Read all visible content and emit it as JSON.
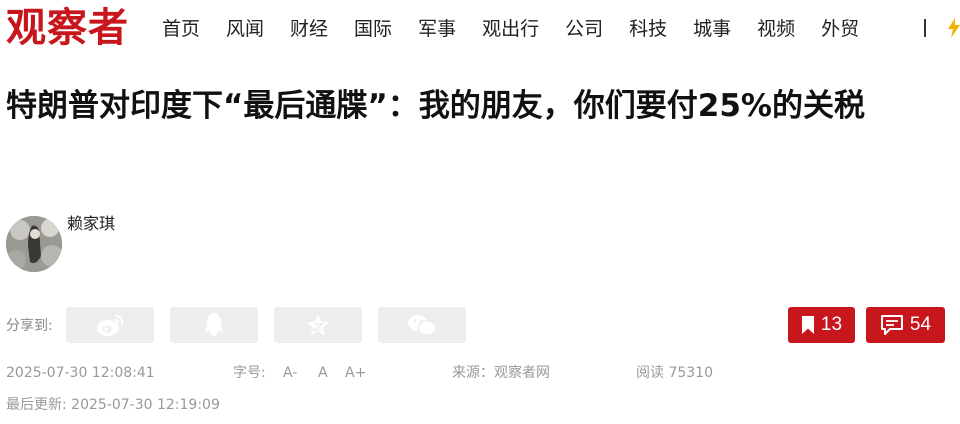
{
  "header": {
    "logo": "观察者",
    "nav_items": [
      "首页",
      "风闻",
      "财经",
      "国际",
      "军事",
      "观出行",
      "公司",
      "科技",
      "城事",
      "视频",
      "外贸"
    ],
    "more_icon": "lightning-icon"
  },
  "article": {
    "title": "特朗普对印度下“最后通牒”：我的朋友，你们要付25%的关税",
    "author": "赖家琪",
    "share_label": "分享到:",
    "share_icons": [
      "weibo-icon",
      "qq-icon",
      "qzone-star-icon",
      "wechat-icon"
    ],
    "bookmark_count": "13",
    "comment_count": "54",
    "publish_time": "2025-07-30 12:08:41",
    "font_size_label": "字号:",
    "font_size_options": [
      "A-",
      "A",
      "A+"
    ],
    "source": "来源：观察者网",
    "read_count": "阅读 75310",
    "updated": "最后更新: 2025-07-30 12:19:09"
  },
  "colors": {
    "brand_red": "#c8161d",
    "share_button_bg": "#ededed",
    "meta_text": "#999999"
  }
}
